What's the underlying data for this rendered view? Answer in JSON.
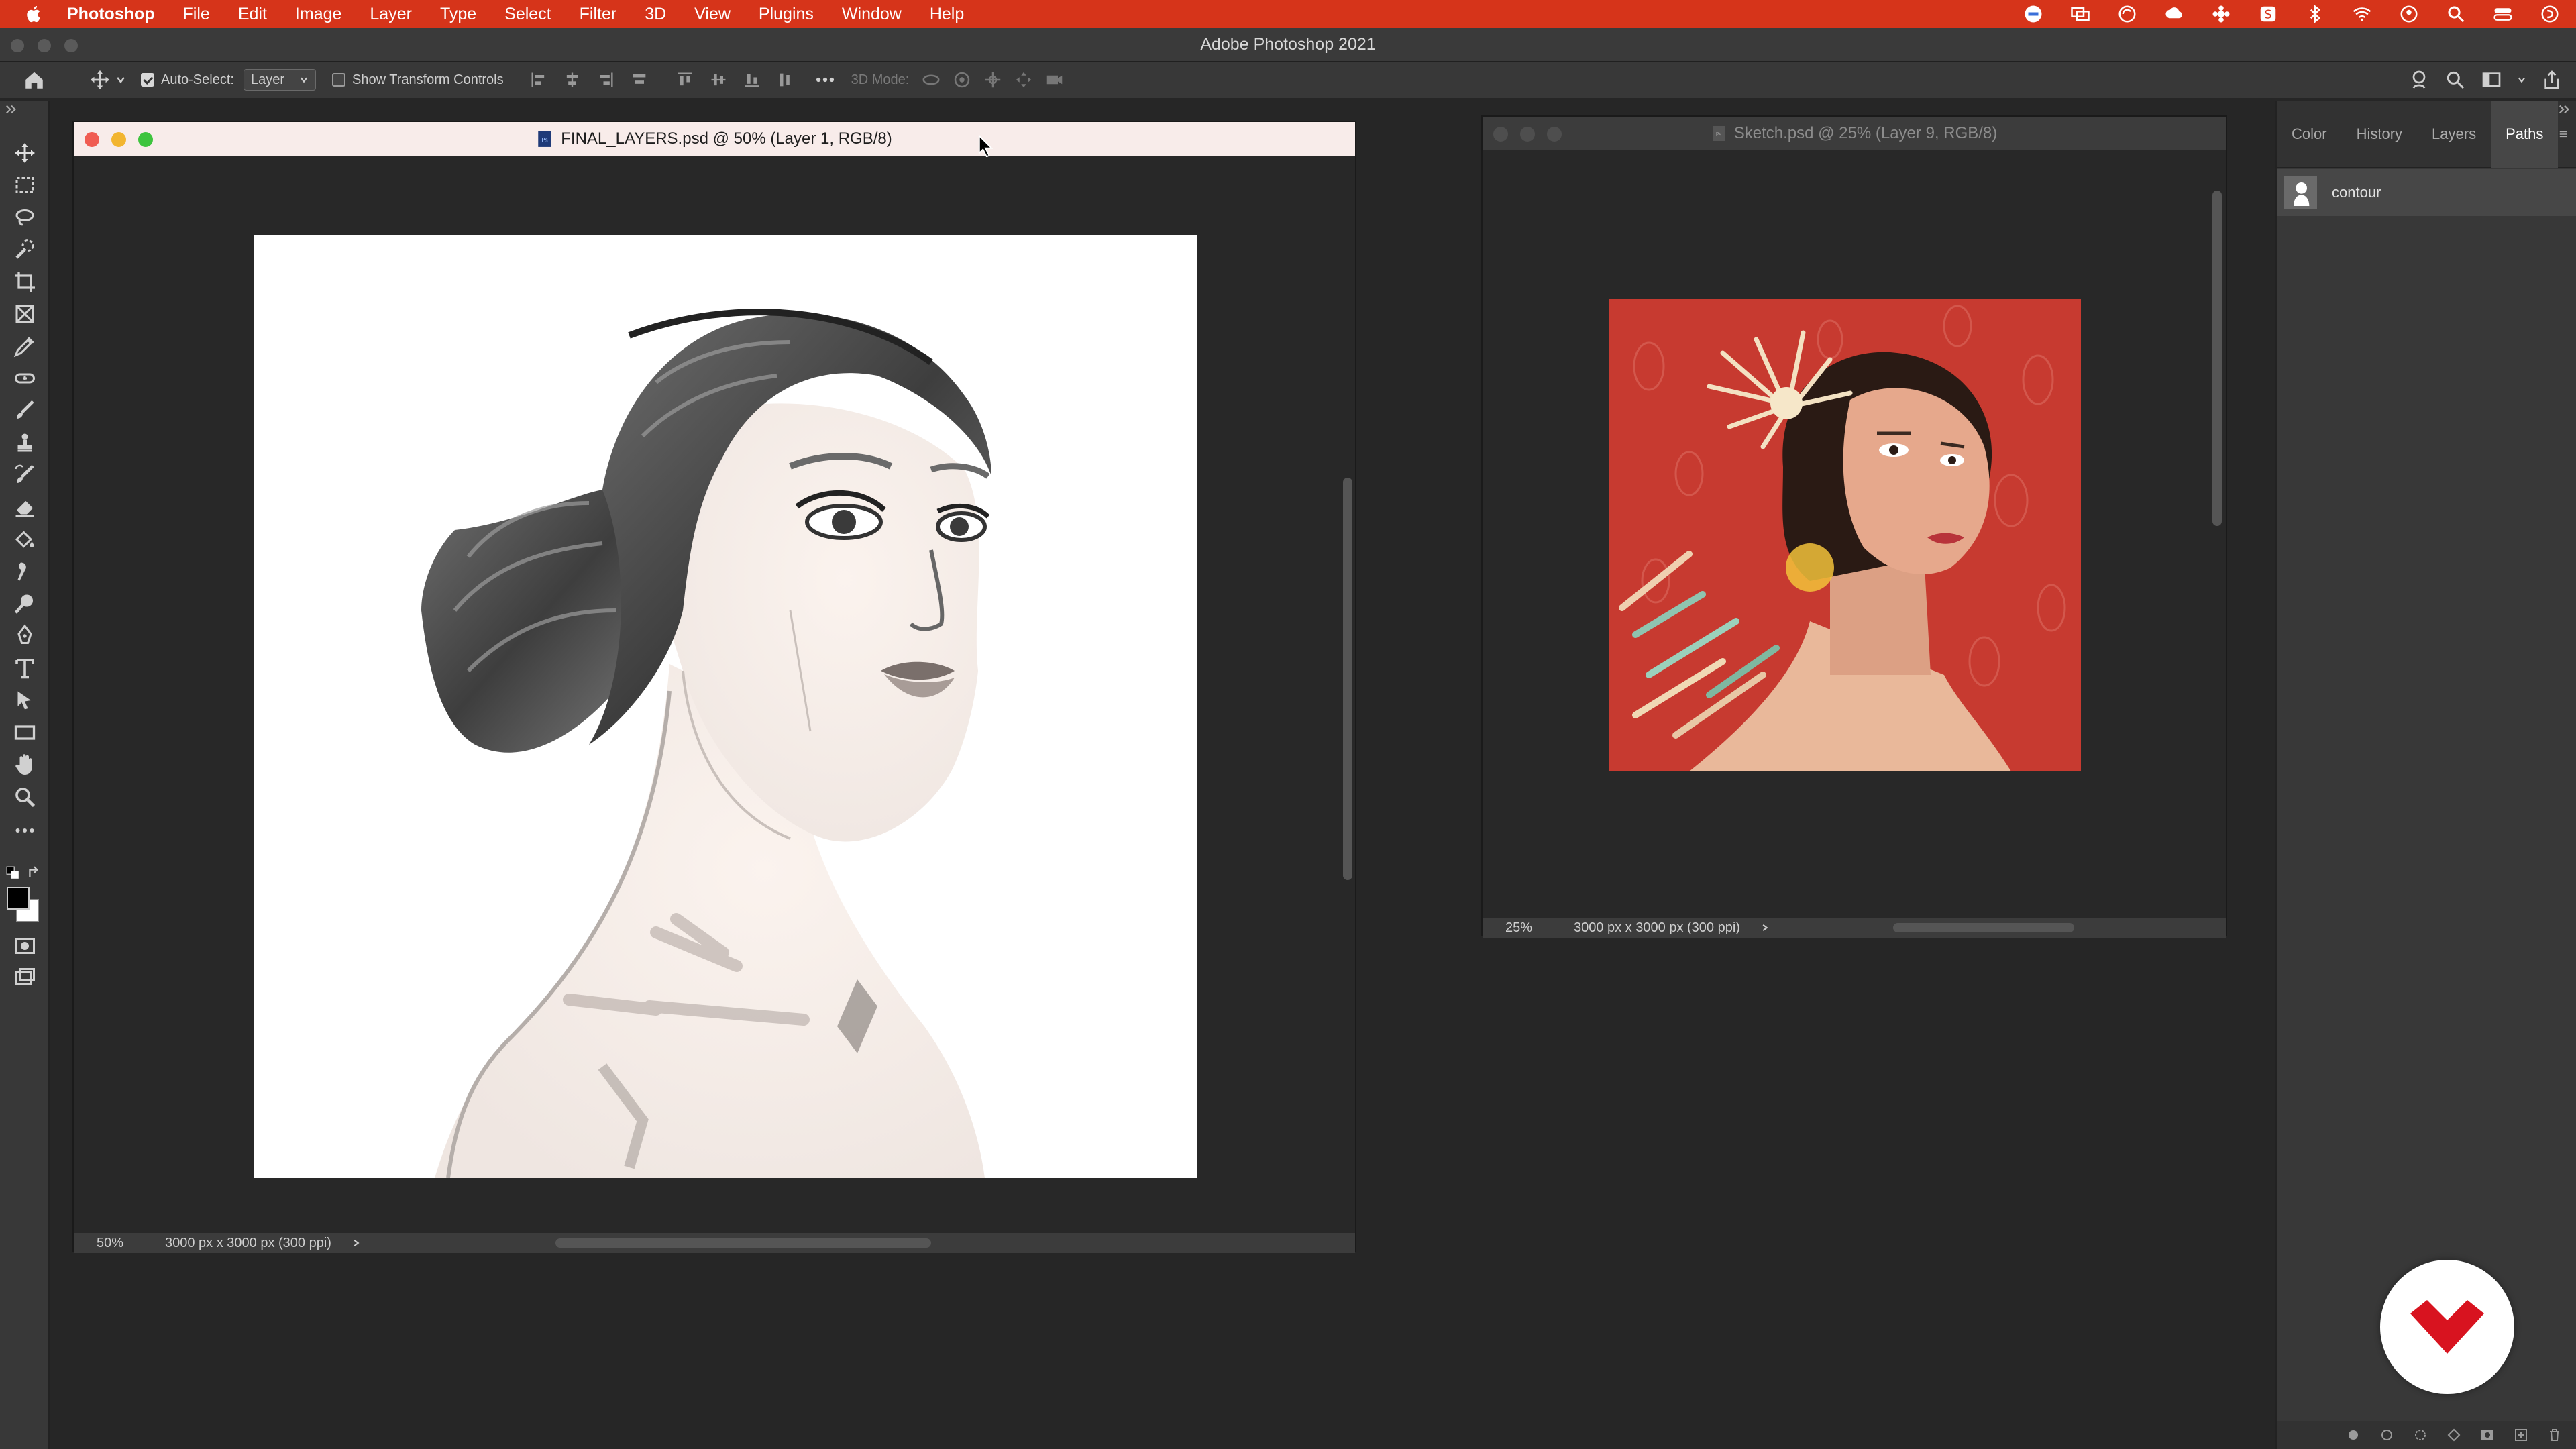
{
  "menubar": {
    "app_name": "Photoshop",
    "items": [
      "File",
      "Edit",
      "Image",
      "Layer",
      "Type",
      "Select",
      "Filter",
      "3D",
      "View",
      "Plugins",
      "Window",
      "Help"
    ],
    "bg_color": "#d6341a"
  },
  "window_title": "Adobe Photoshop 2021",
  "options_bar": {
    "auto_select_label": "Auto-Select:",
    "auto_select_value": "Layer",
    "transform_label": "Show Transform Controls",
    "mode_label": "3D Mode:"
  },
  "doc1": {
    "title": "FINAL_LAYERS.psd @ 50% (Layer 1, RGB/8)",
    "zoom": "50%",
    "info": "3000 px x 3000 px (300 ppi)"
  },
  "doc2": {
    "title": "Sketch.psd @ 25% (Layer 9, RGB/8)",
    "zoom": "25%",
    "info": "3000 px x 3000 px (300 ppi)",
    "canvas_color": "#c73a30"
  },
  "panel": {
    "tabs": [
      "Color",
      "History",
      "Layers",
      "Paths"
    ],
    "active_tab": "Paths",
    "path_name": "contour"
  }
}
